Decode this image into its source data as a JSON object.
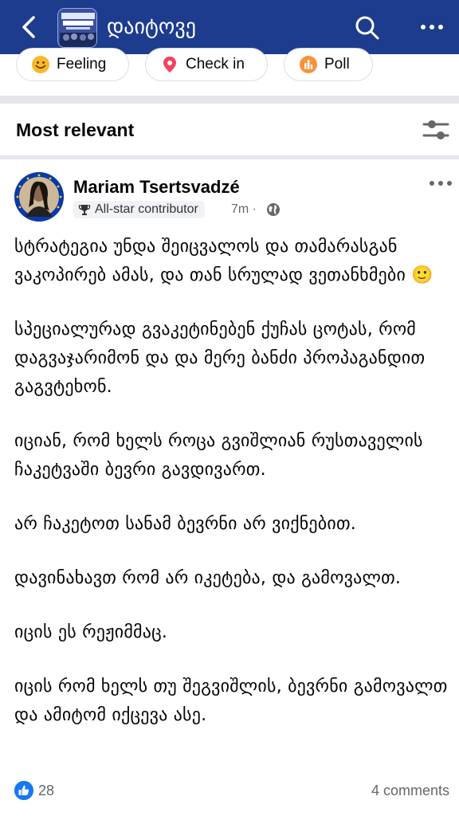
{
  "header": {
    "title": "დაიტოვე",
    "back_icon": "chevron-left-icon",
    "search_icon": "search-icon",
    "more_icon": "more-horizontal-icon",
    "bar_color": "#1d3c8e"
  },
  "composer_chips": [
    {
      "label": "Feeling",
      "icon": "smiley-icon",
      "color": "#f7b928"
    },
    {
      "label": "Check in",
      "icon": "location-pin-icon",
      "color": "#f3425f"
    },
    {
      "label": "Poll",
      "icon": "poll-icon",
      "color": "#f7923b"
    }
  ],
  "sort": {
    "label": "Most relevant",
    "filter_icon": "sliders-icon"
  },
  "post": {
    "author": "Mariam Tsertsvadzé",
    "badge": "All-star contributor",
    "badge_icon": "trophy-icon",
    "time": "7m ·",
    "privacy_icon": "globe-icon",
    "paragraphs": [
      "სტრატეგია უნდა შეიცვალოს და თამარასგან ვაკოპირებ ამას, და თან სრულად ვეთანხმები 🙂",
      "სპეციალურად გვაკეტინებენ ქუჩას ცოტას, რომ დაგვაჯარიმონ და და მერე ბანძი პროპაგანდით გაგვტეხონ.",
      "იციან, რომ ხელს როცა გვიშლიან რუსთაველის ჩაკეტვაში ბევრი გავდივართ.",
      "არ ჩაკეტოთ სანამ ბევრნი არ ვიქნებით.",
      "დავინახავთ რომ არ იკეტება, და გამოვალთ.",
      "იცის ეს რეჟიმმაც.",
      "იცის რომ ხელს თუ შეგვიშლის, ბევრნი გამოვალთ და ამიტომ იქცევა ასე."
    ],
    "likes": "28",
    "like_color": "#1877f2",
    "comments": "4 comments"
  }
}
